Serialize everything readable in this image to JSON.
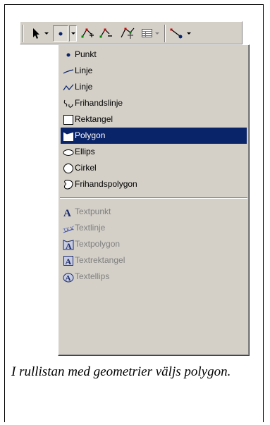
{
  "menu": {
    "items": [
      {
        "label": "Punkt",
        "icon": "point-icon"
      },
      {
        "label": "Linje",
        "icon": "line-icon"
      },
      {
        "label": "Linje",
        "icon": "polyline-icon"
      },
      {
        "label": "Frihandslinje",
        "icon": "freehand-line-icon"
      },
      {
        "label": "Rektangel",
        "icon": "rectangle-icon"
      },
      {
        "label": "Polygon",
        "icon": "polygon-icon",
        "selected": true
      },
      {
        "label": "Ellips",
        "icon": "ellipse-icon"
      },
      {
        "label": "Cirkel",
        "icon": "circle-icon"
      },
      {
        "label": "Frihandspolygon",
        "icon": "freehand-polygon-icon"
      }
    ],
    "text_items": [
      {
        "label": "Textpunkt",
        "icon": "text-point-icon",
        "disabled": true
      },
      {
        "label": "Textlinje",
        "icon": "text-line-icon",
        "disabled": true
      },
      {
        "label": "Textpolygon",
        "icon": "text-polygon-icon",
        "disabled": true
      },
      {
        "label": "Textrektangel",
        "icon": "text-rectangle-icon",
        "disabled": true
      },
      {
        "label": "Textellips",
        "icon": "text-ellipse-icon",
        "disabled": true
      }
    ]
  },
  "caption": "I rullistan med geometrier väljs polygon.",
  "colors": {
    "selection": "#0a246a",
    "face": "#d4d0c8",
    "disabled_text": "#808080"
  }
}
